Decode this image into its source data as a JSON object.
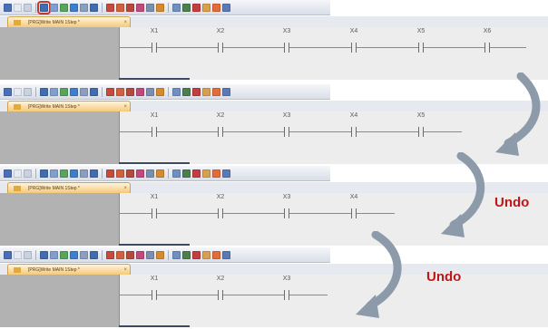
{
  "tab_label": "[PRG]Write MAIN 1Step *",
  "tab_close": "×",
  "undo_label": "Undo",
  "panels": [
    {
      "contacts": [
        "X1",
        "X2",
        "X3",
        "X4",
        "X5",
        "X6"
      ],
      "undo_highlight": true
    },
    {
      "contacts": [
        "X1",
        "X2",
        "X3",
        "X4",
        "X5"
      ],
      "undo_highlight": false
    },
    {
      "contacts": [
        "X1",
        "X2",
        "X3",
        "X4"
      ],
      "undo_highlight": false
    },
    {
      "contacts": [
        "X1",
        "X2",
        "X3"
      ],
      "undo_highlight": false
    }
  ],
  "toolbar_icon_colors": [
    "#4a6fb5",
    "#e6eaf1",
    "#c9d2e0",
    "#3f6db0",
    "#7fa0cf",
    "#59a35c",
    "#3c7ecf",
    "#8a9fbf",
    "#3f6db0",
    "#c54b3a",
    "#d0603e",
    "#b8483b",
    "#c04a7a",
    "#7a8fb0",
    "#d48a2e",
    "#6f8fc0",
    "#4d7f4a",
    "#c33e3e",
    "#d8a04a",
    "#e36d3a",
    "#5a79b6"
  ],
  "colors": {
    "arrow": "#8c9aaa",
    "highlight": "#c0392b",
    "undo_text": "#c01616",
    "rail": "#b2b2b2",
    "tab": "#f5c97a"
  }
}
